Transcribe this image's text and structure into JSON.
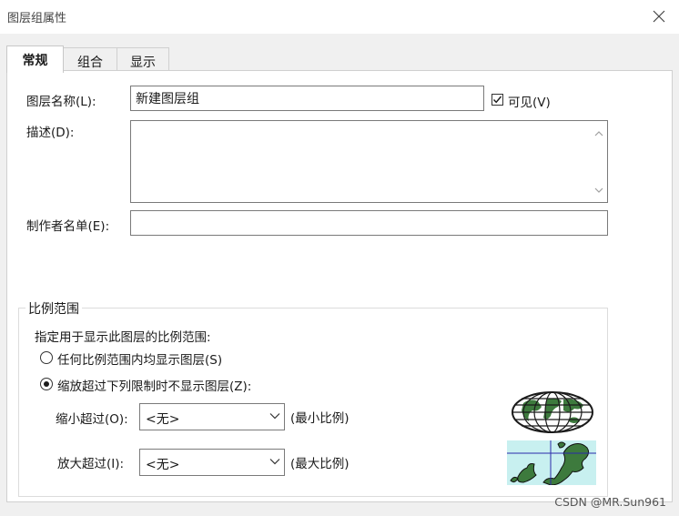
{
  "window": {
    "title": "图层组属性",
    "close_icon": "close-icon"
  },
  "tabs": [
    {
      "label": "常规",
      "active": true
    },
    {
      "label": "组合",
      "active": false
    },
    {
      "label": "显示",
      "active": false
    }
  ],
  "general": {
    "layer_name_label": "图层名称(L):",
    "layer_name_value": "新建图层组",
    "visible_label": "可见(V)",
    "visible_checked": true,
    "description_label": "描述(D):",
    "description_value": "",
    "credits_label": "制作者名单(E):",
    "credits_value": ""
  },
  "scale_range": {
    "group_title": "比例范围",
    "instruction": "指定用于显示此图层的比例范围:",
    "option_any": "任何比例范围内均显示图层(S)",
    "option_limit": "缩放超过下列限制时不显示图层(Z):",
    "selected": "option_limit",
    "zoom_out_label": "缩小超过(O):",
    "zoom_out_value": "<无>",
    "zoom_out_hint": "(最小比例)",
    "zoom_in_label": "放大超过(I):",
    "zoom_in_value": "<无>",
    "zoom_in_hint": "(最大比例)",
    "min_scale_icon": "globe-icon",
    "max_scale_icon": "map-detail-icon"
  },
  "watermark": "CSDN @MR.Sun961",
  "colors": {
    "background": "#f0f0f0",
    "panel": "#ffffff",
    "border": "#7a7a7a",
    "globe_land": "#3d7a3d",
    "map_sea": "#c8f0f0"
  }
}
